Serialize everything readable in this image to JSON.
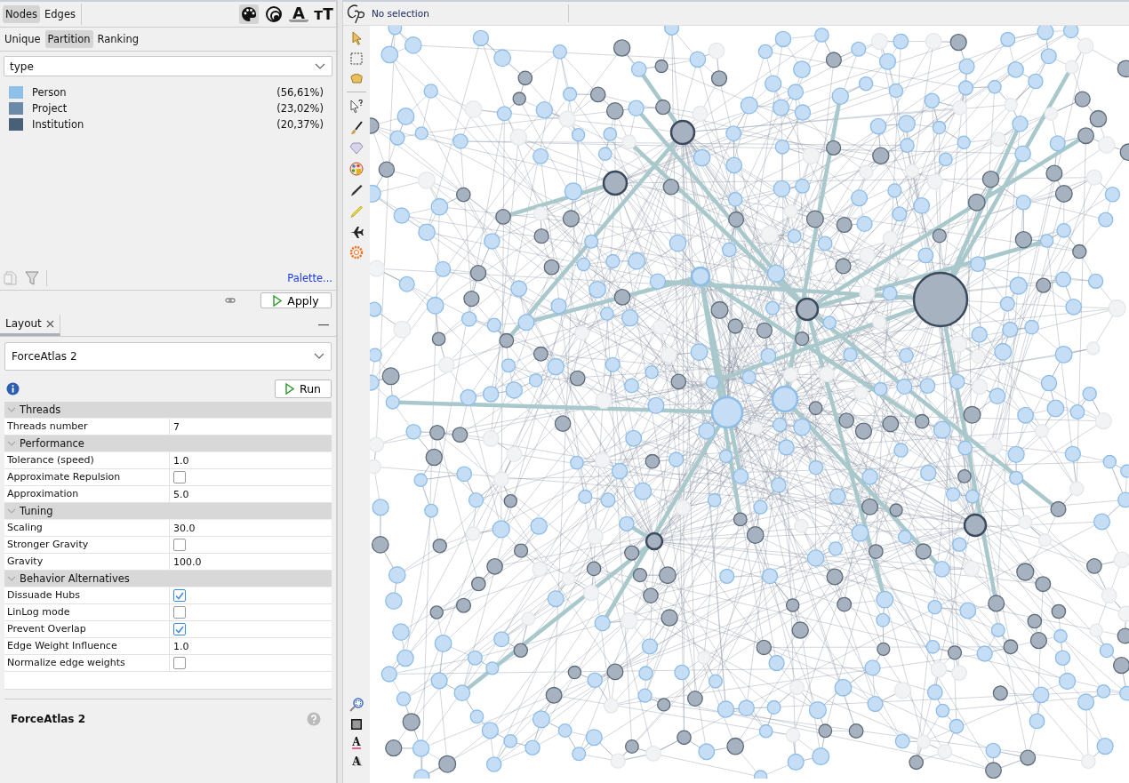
{
  "appearance": {
    "tabs": [
      {
        "label": "Nodes",
        "selected": true
      },
      {
        "label": "Edges",
        "selected": false
      }
    ],
    "tools": [
      {
        "kind": "color",
        "selected": true
      },
      {
        "kind": "size",
        "selected": false
      },
      {
        "kind": "label-color",
        "glyph": "A",
        "selected": false
      },
      {
        "kind": "label-size",
        "glyph": "ᴛT",
        "selected": false
      }
    ],
    "modes": [
      {
        "label": "Unique",
        "selected": false
      },
      {
        "label": "Partition",
        "selected": true
      },
      {
        "label": "Ranking",
        "selected": false
      }
    ],
    "attribute": "type",
    "partition": [
      {
        "label": "Person",
        "share": "(56,61%)",
        "color": "#8fc0ea"
      },
      {
        "label": "Project",
        "share": "(23,02%)",
        "color": "#6a8aa8"
      },
      {
        "label": "Institution",
        "share": "(20,37%)",
        "color": "#4a6078"
      }
    ],
    "palette_link": "Palette...",
    "apply_button": "Apply"
  },
  "layout": {
    "tab": "Layout",
    "algorithm": "ForceAtlas 2",
    "run_button": "Run",
    "groups": [
      {
        "title": "Threads",
        "expanded": true,
        "properties": [
          {
            "name": "Threads number",
            "kind": "text",
            "value": "7"
          }
        ]
      },
      {
        "title": "Performance",
        "expanded": true,
        "properties": [
          {
            "name": "Tolerance (speed)",
            "kind": "text",
            "value": "1.0"
          },
          {
            "name": "Approximate Repulsion",
            "kind": "checkbox",
            "checked": false
          },
          {
            "name": "Approximation",
            "kind": "text",
            "value": "5.0"
          }
        ]
      },
      {
        "title": "Tuning",
        "expanded": true,
        "properties": [
          {
            "name": "Scaling",
            "kind": "text",
            "value": "30.0"
          },
          {
            "name": "Stronger Gravity",
            "kind": "checkbox",
            "checked": false
          },
          {
            "name": "Gravity",
            "kind": "text",
            "value": "100.0"
          }
        ]
      },
      {
        "title": "Behavior Alternatives",
        "expanded": true,
        "properties": [
          {
            "name": "Dissuade Hubs",
            "kind": "checkbox",
            "checked": true
          },
          {
            "name": "LinLog mode",
            "kind": "checkbox",
            "checked": false
          },
          {
            "name": "Prevent Overlap",
            "kind": "checkbox",
            "checked": true
          },
          {
            "name": "Edge Weight Influence",
            "kind": "text",
            "value": "1.0"
          },
          {
            "name": "Normalize edge weights",
            "kind": "checkbox",
            "checked": false
          }
        ]
      }
    ],
    "description_title": "ForceAtlas 2"
  },
  "graph": {
    "status": "No selection",
    "bottom_tools": [
      {
        "kind": "zoom"
      },
      {
        "kind": "square"
      },
      {
        "kind": "label-color",
        "glyph": "A"
      },
      {
        "kind": "label-shadow",
        "glyph": "A"
      }
    ]
  }
}
